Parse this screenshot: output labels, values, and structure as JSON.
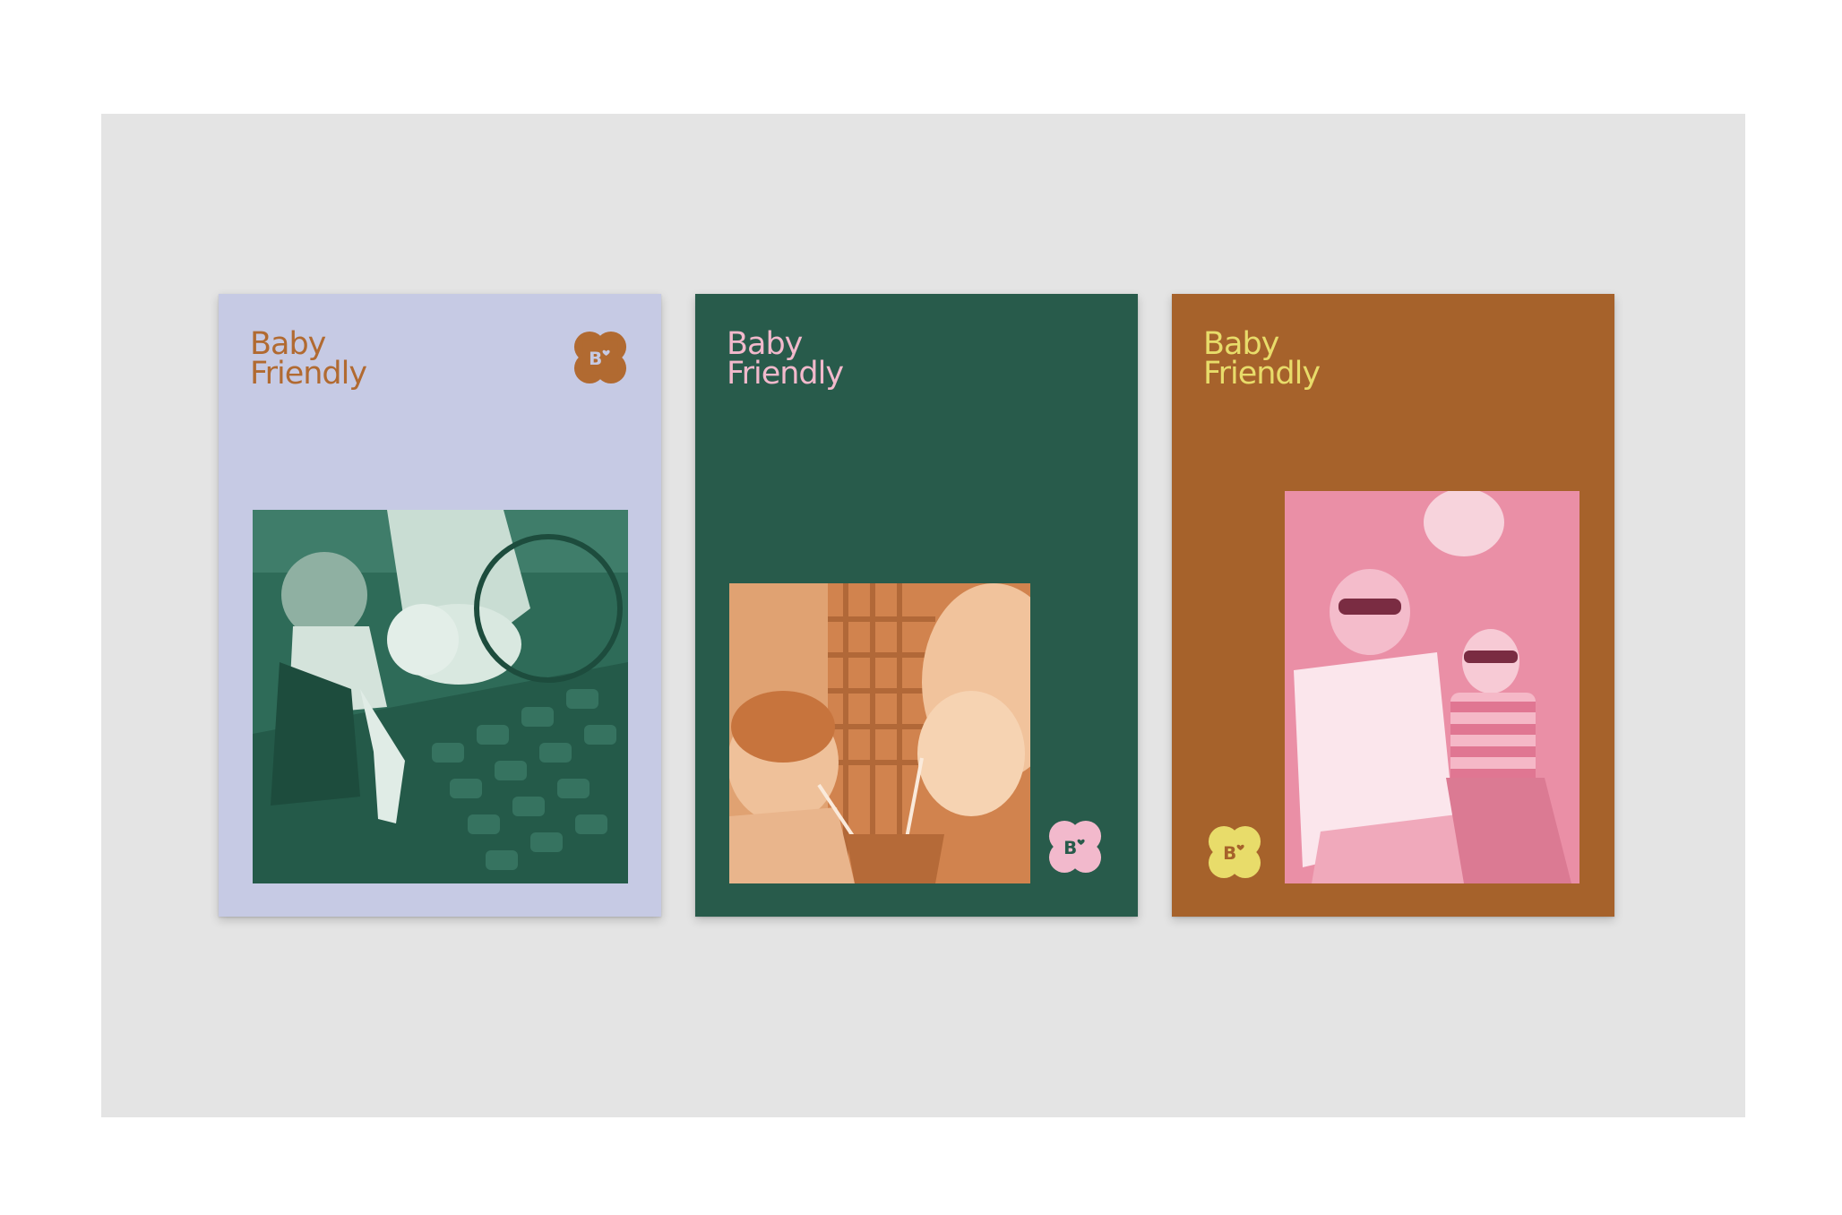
{
  "posters": [
    {
      "id": "lavender",
      "title_line1": "Baby",
      "title_line2": "Friendly",
      "logo_letter": "B",
      "colors": {
        "background": "#c6cae4",
        "text": "#b16a31",
        "photo_tint": "#2e6b58",
        "logo_fill": "#b16a31"
      },
      "photo_icon": "bicycle-child-photo"
    },
    {
      "id": "green",
      "title_line1": "Baby",
      "title_line2": "Friendly",
      "logo_letter": "B",
      "colors": {
        "background": "#285b4b",
        "text": "#f2b9cc",
        "photo_tint": "#d1834e",
        "logo_fill": "#f2b9cc"
      },
      "photo_icon": "mother-child-straw-photo"
    },
    {
      "id": "brown",
      "title_line1": "Baby",
      "title_line2": "Friendly",
      "logo_letter": "B",
      "colors": {
        "background": "#a6622b",
        "text": "#e8dc6a",
        "photo_tint": "#ea8fa6",
        "logo_fill": "#e8dc6a"
      },
      "photo_icon": "father-son-sunglasses-photo"
    }
  ]
}
